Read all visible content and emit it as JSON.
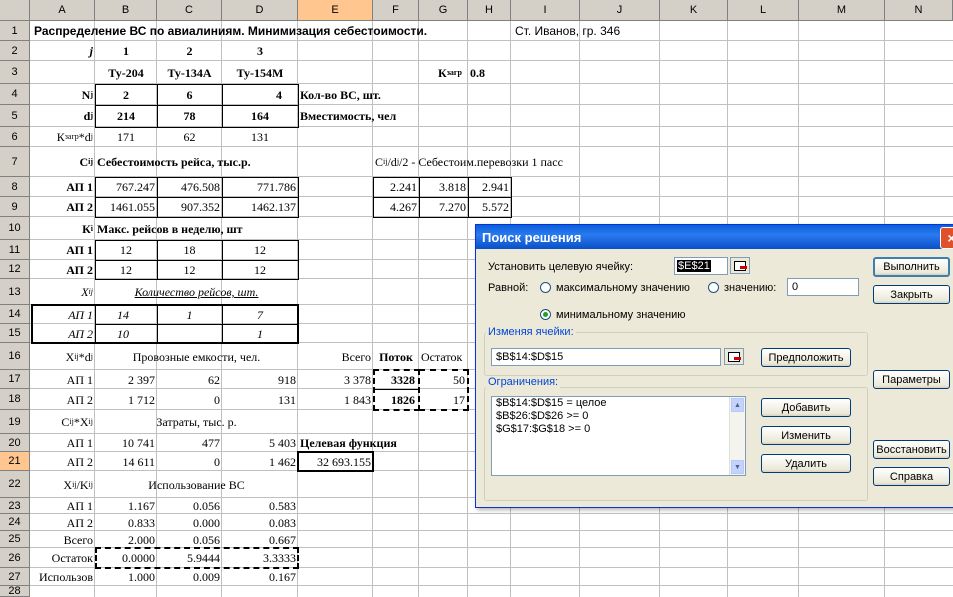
{
  "columns": [
    "A",
    "B",
    "C",
    "D",
    "E",
    "F",
    "G",
    "H",
    "I",
    "J",
    "K",
    "L",
    "M",
    "N"
  ],
  "rows": [
    "1",
    "2",
    "3",
    "4",
    "5",
    "6",
    "7",
    "8",
    "9",
    "10",
    "11",
    "12",
    "13",
    "14",
    "15",
    "16",
    "17",
    "18",
    "19",
    "20",
    "21",
    "22",
    "23",
    "24",
    "25",
    "26",
    "27",
    "28"
  ],
  "name_box_hint": "",
  "r1": {
    "title": "Распределение ВС по авиалиниям. Минимизация себестоимости.",
    "author": "Ст. Иванов, гр. 346"
  },
  "r2": {
    "a": "j",
    "b": "1",
    "c": "2",
    "d": "3"
  },
  "r3": {
    "b": "Ту-204",
    "c": "Ту-134А",
    "d": "Ту-154М",
    "g_main": "К",
    "g_sub": "загр",
    "h": "0.8"
  },
  "r4": {
    "a_main": "N",
    "a_sub": "j",
    "b": "2",
    "c": "6",
    "d": "4",
    "e": "Кол-во ВС, шт."
  },
  "r5": {
    "a_main": "d",
    "a_sub": "j",
    "b": "214",
    "c": "78",
    "d": "164",
    "e": "Вместимость, чел"
  },
  "r6": {
    "a_main": "К",
    "a_sub": "загр",
    "a_tail": "*d",
    "a_sub2": "j",
    "b": "171",
    "c": "62",
    "d": "131"
  },
  "r7": {
    "a_main": "C",
    "a_sub": "ij",
    "b": "Себестоимость рейса, тыс.р.",
    "f_main": "C",
    "f_sub": "ij",
    "f_mid": "/d",
    "f_sub2": "j",
    "f_tail": "/2 - Себестоим.перевозки 1 пасс"
  },
  "r8": {
    "a": "АП 1",
    "b": "767.247",
    "c": "476.508",
    "d": "771.786",
    "f": "2.241",
    "g": "3.818",
    "h": "2.941"
  },
  "r9": {
    "a": "АП 2",
    "b": "1461.055",
    "c": "907.352",
    "d": "1462.137",
    "f": "4.267",
    "g": "7.270",
    "h": "5.572"
  },
  "r10": {
    "a_main": "К",
    "a_sub": "i",
    "b": "Макс. рейсов в неделю, шт"
  },
  "r11": {
    "a": "АП 1",
    "b": "12",
    "c": "18",
    "d": "12"
  },
  "r12": {
    "a": "АП 2",
    "b": "12",
    "c": "12",
    "d": "12"
  },
  "r13": {
    "a_main": "X",
    "a_sub": "ij",
    "b": "Количество рейсов, шт."
  },
  "r14": {
    "a": "АП 1",
    "b": "14",
    "c": "1",
    "d": "7"
  },
  "r15": {
    "a": "АП 2",
    "b": "10",
    "c": "",
    "d": "1"
  },
  "r16": {
    "a_main": "X",
    "a_sub": "ij",
    "a_tail": "*d",
    "a_sub2": "j",
    "b": "Провозные емкости, чел.",
    "e": "Всего",
    "f": "Поток",
    "g": "Остаток"
  },
  "r17": {
    "a": "АП 1",
    "b": "2 397",
    "c": "62",
    "d": "918",
    "e": "3 378",
    "f": "3328",
    "g": "50"
  },
  "r18": {
    "a": "АП 2",
    "b": "1 712",
    "c": "0",
    "d": "131",
    "e": "1 843",
    "f": "1826",
    "g": "17"
  },
  "r19": {
    "a_main": "C",
    "a_sub": "ij",
    "a_tail": "*X",
    "a_sub2": "ij",
    "b": "Затраты, тыс. р."
  },
  "r20": {
    "a": "АП 1",
    "b": "10 741",
    "c": "477",
    "d": "5 403",
    "e": "Целевая функция"
  },
  "r21": {
    "a": "АП 2",
    "b": "14 611",
    "c": "0",
    "d": "1 462",
    "e": "32 693.155"
  },
  "r22": {
    "a_main": "X",
    "a_sub": "ij",
    "a_tail": "/K",
    "a_sub2": "ij",
    "b": "Использование ВС"
  },
  "r23": {
    "a": "АП 1",
    "b": "1.167",
    "c": "0.056",
    "d": "0.583"
  },
  "r24": {
    "a": "АП 2",
    "b": "0.833",
    "c": "0.000",
    "d": "0.083"
  },
  "r25": {
    "a": "Всего",
    "b": "2.000",
    "c": "0.056",
    "d": "0.667"
  },
  "r26": {
    "a": "Остаток",
    "b": "0.0000",
    "c": "5.9444",
    "d": "3.3333"
  },
  "r27": {
    "a": "Использов",
    "b": "1.000",
    "c": "0.009",
    "d": "0.167"
  },
  "dialog": {
    "title": "Поиск решения",
    "target_label": "Установить целевую ячейку:",
    "target_value": "$E$21",
    "equal_label": "Равной:",
    "opt_max": "максимальному значению",
    "opt_value": "значению:",
    "opt_value_input": "0",
    "opt_min": "минимальному значению",
    "changing_label": "Изменяя ячейки:",
    "changing_value": "$B$14:$D$15",
    "guess_btn": "Предположить",
    "constraints_label": "Ограничения:",
    "constraints": [
      "$B$14:$D$15 = целое",
      "$B$26:$D$26 >= 0",
      "$G$17:$G$18 >= 0"
    ],
    "add_btn": "Добавить",
    "change_btn": "Изменить",
    "delete_btn": "Удалить",
    "run_btn": "Выполнить",
    "close_btn": "Закрыть",
    "params_btn": "Параметры",
    "restore_btn": "Восстановить",
    "help_btn": "Справка",
    "close_icon": "×"
  }
}
